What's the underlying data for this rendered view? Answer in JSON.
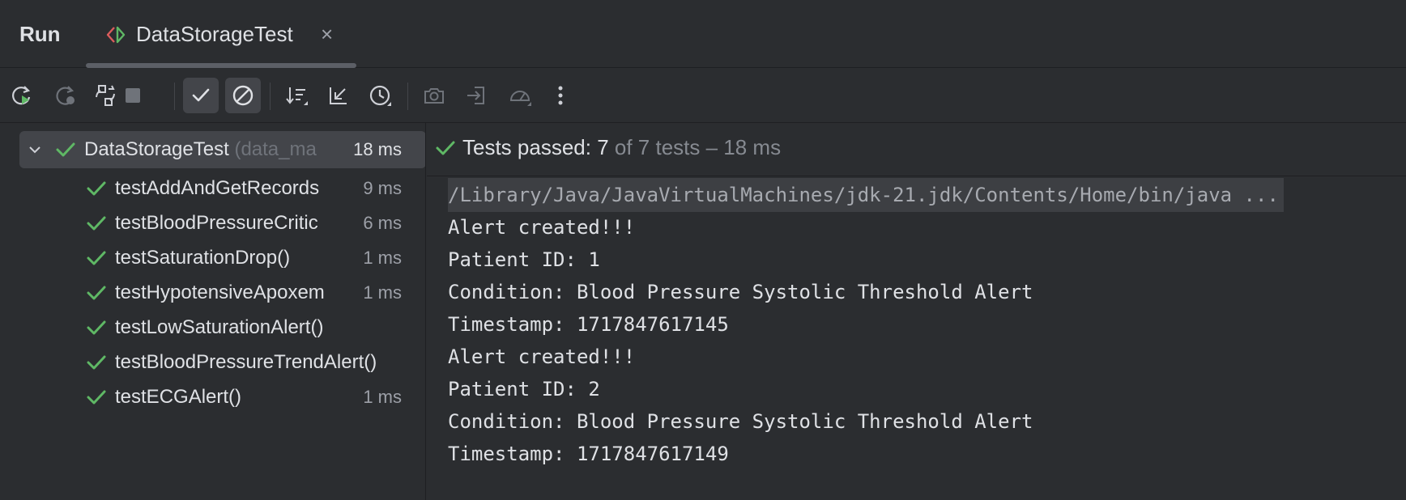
{
  "header": {
    "run_label": "Run",
    "tab_label": "DataStorageTest",
    "close_symbol": "×"
  },
  "toolbar": {
    "buttons": [
      {
        "name": "rerun",
        "icon": "rerun-icon"
      },
      {
        "name": "rerun-failed",
        "icon": "rerun-failed-icon"
      },
      {
        "name": "toggle-auto-test",
        "icon": "auto-rerun-icon"
      },
      {
        "name": "stop",
        "icon": "stop-icon"
      },
      {
        "name": "show-passed",
        "icon": "check-icon"
      },
      {
        "name": "show-ignored",
        "icon": "ignored-icon"
      },
      {
        "name": "sort",
        "icon": "sort-icon"
      },
      {
        "name": "collapse-all",
        "icon": "collapse-icon"
      },
      {
        "name": "test-history",
        "icon": "history-icon"
      },
      {
        "name": "screenshot",
        "icon": "camera-icon"
      },
      {
        "name": "import-tests",
        "icon": "import-icon"
      },
      {
        "name": "coverage",
        "icon": "gauge-icon"
      },
      {
        "name": "more",
        "icon": "more-icon"
      }
    ]
  },
  "tree": {
    "root": {
      "name": "DataStorageTest",
      "package": "(data_ma",
      "time": "18 ms",
      "status": "passed"
    },
    "tests": [
      {
        "name": "testAddAndGetRecords",
        "time": "9 ms"
      },
      {
        "name": "testBloodPressureCritic",
        "time": "6 ms"
      },
      {
        "name": "testSaturationDrop()",
        "time": "1 ms"
      },
      {
        "name": "testHypotensiveApoxem",
        "time": "1 ms"
      },
      {
        "name": "testLowSaturationAlert()",
        "time": ""
      },
      {
        "name": "testBloodPressureTrendAlert()",
        "time": ""
      },
      {
        "name": "testECGAlert()",
        "time": "1 ms"
      }
    ]
  },
  "status": {
    "passed_label": "Tests passed: 7",
    "rest_label": " of 7 tests – 18 ms"
  },
  "console": {
    "command": "/Library/Java/JavaVirtualMachines/jdk-21.jdk/Contents/Home/bin/java ...",
    "lines": [
      "Alert created!!!",
      "Patient ID: 1",
      "Condition: Blood Pressure Systolic Threshold Alert",
      "Timestamp: 1717847617145",
      "Alert created!!!",
      "Patient ID: 2",
      "Condition: Blood Pressure Systolic Threshold Alert",
      "Timestamp: 1717847617149"
    ]
  },
  "colors": {
    "background": "#2b2d30",
    "check_green": "#5fb865",
    "text": "#dfe1e5",
    "muted": "#868a91"
  }
}
